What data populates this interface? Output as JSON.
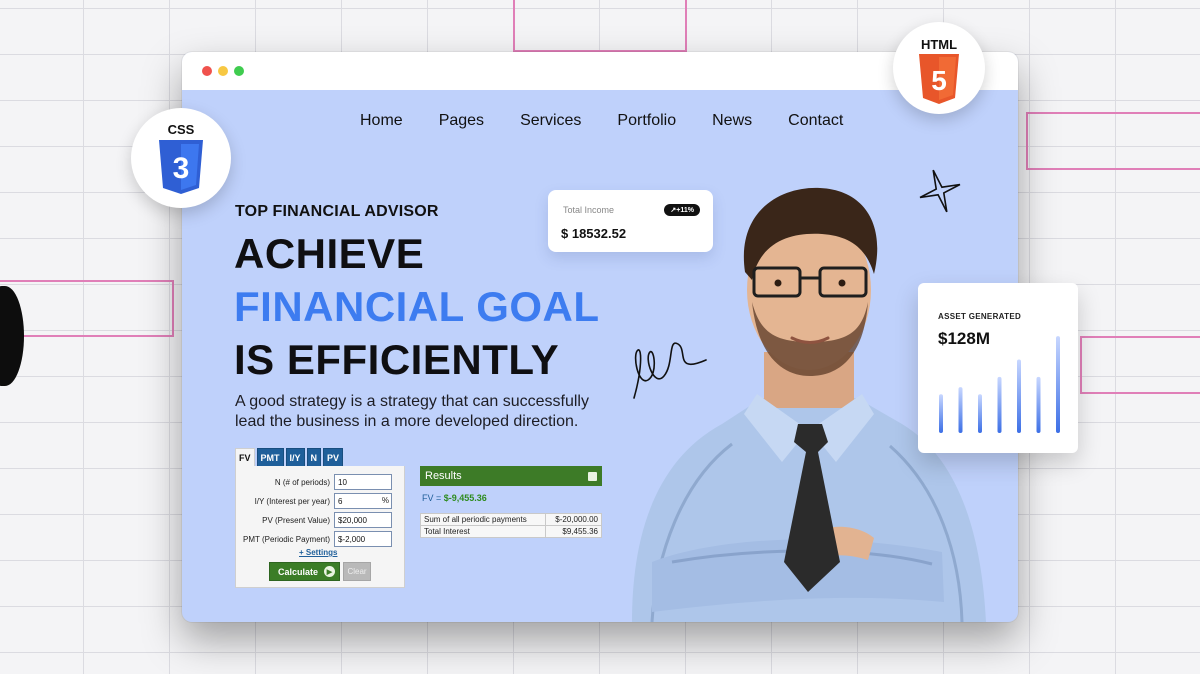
{
  "window": {
    "nav": [
      "Home",
      "Pages",
      "Services",
      "Portfolio",
      "News",
      "Contact"
    ]
  },
  "hero": {
    "eyebrow": "TOP FINANCIAL ADVISOR",
    "headline_line1": "ACHIEVE",
    "headline_line2": "FINANCIAL GOAL",
    "headline_line3": "IS EFFICIENTLY",
    "description": "A good strategy is a strategy that can successfully lead the business in a more developed direction."
  },
  "calculator": {
    "tabs": [
      "FV",
      "PMT",
      "I/Y",
      "N",
      "PV"
    ],
    "active_tab": "FV",
    "fields": [
      {
        "label": "N (# of periods)",
        "value": "10"
      },
      {
        "label": "I/Y (Interest per year)",
        "value": "6",
        "suffix": "%"
      },
      {
        "label": "PV (Present Value)",
        "value": "$20,000"
      },
      {
        "label": "PMT (Periodic Payment)",
        "value": "$-2,000"
      }
    ],
    "settings_link": "+ Settings",
    "calculate_label": "Calculate",
    "clear_label": "Clear"
  },
  "results": {
    "title": "Results",
    "fv_label": "FV = ",
    "fv_value": "$-9,455.36",
    "rows": [
      {
        "label": "Sum of all periodic payments",
        "value": "$-20,000.00"
      },
      {
        "label": "Total Interest",
        "value": "$9,455.36"
      }
    ]
  },
  "income_card": {
    "label": "Total Income",
    "badge": "+11%",
    "value": "$ 18532.52"
  },
  "asset_card": {
    "label": "ASSET GENERATED",
    "value": "$128M",
    "bars": [
      0.38,
      0.45,
      0.38,
      0.55,
      0.72,
      0.55,
      0.95
    ]
  },
  "badges": {
    "css": "CSS",
    "css_number": "3",
    "html": "HTML",
    "html_number": "5"
  },
  "colors": {
    "window_bg": "#bfd1fb",
    "accent_blue": "#3d7cf0",
    "css_blue": "#2f5fd4",
    "html_orange": "#e8562a",
    "results_green": "#3d7b27"
  }
}
